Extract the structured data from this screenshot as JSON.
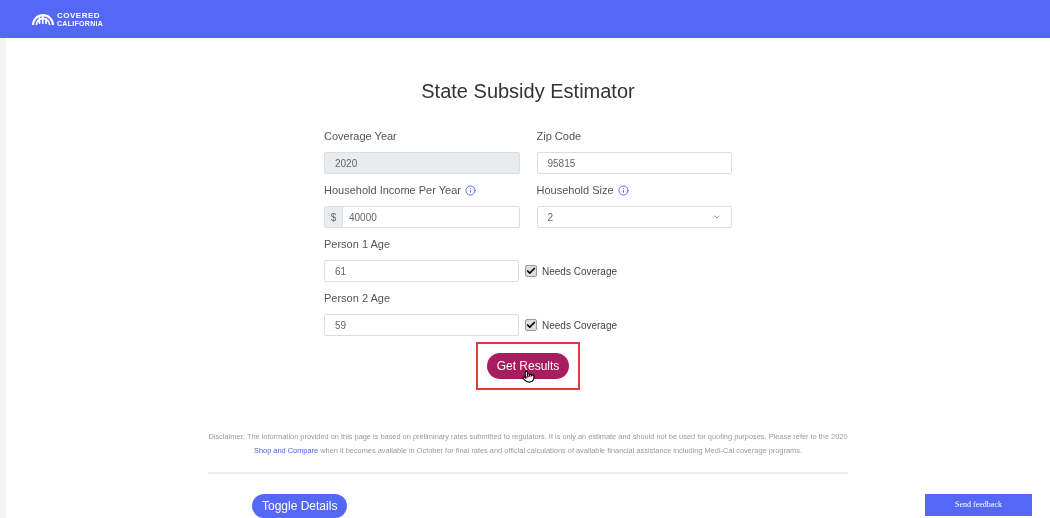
{
  "header": {
    "logo": {
      "line_1": "COVERED",
      "line_2": "CALIFORNIA"
    }
  },
  "title": "State Subsidy Estimator",
  "fields": [
    {
      "kind": "text",
      "label": "Coverage Year",
      "value": "2020",
      "disabled": true,
      "info": false
    },
    {
      "kind": "text",
      "label": "Zip Code",
      "value": "95815",
      "disabled": false,
      "info": false
    },
    {
      "kind": "prefixed",
      "label": "Household Income Per Year",
      "prefix": "$",
      "value": "40000",
      "disabled": false,
      "info": true
    },
    {
      "kind": "select",
      "label": "Household Size",
      "value": "2",
      "disabled": false,
      "info": true
    }
  ],
  "persons": [
    {
      "label": "Person 1 Age",
      "value": "61",
      "needs_coverage": {
        "label": "Needs Coverage",
        "checked": true
      }
    },
    {
      "label": "Person 2 Age",
      "value": "59",
      "needs_coverage": {
        "label": "Needs Coverage",
        "checked": true
      }
    }
  ],
  "submit_button": {
    "label": "Get Results",
    "highlighted": true
  },
  "disclaimer": {
    "text_before": "Disclaimer: The information provided on this page is based on preliminary rates submitted to regulators. It is only an estimate and should not be used for quoting purposes. Please refer to the 2020",
    "link": "Shop and Compare",
    "text_after": "when it becomes available in October for final rates and official calculations of available financial assistance including Medi-Cal coverage programs."
  },
  "toggle_button": "Toggle Details",
  "feedback_button": "Send feedback"
}
